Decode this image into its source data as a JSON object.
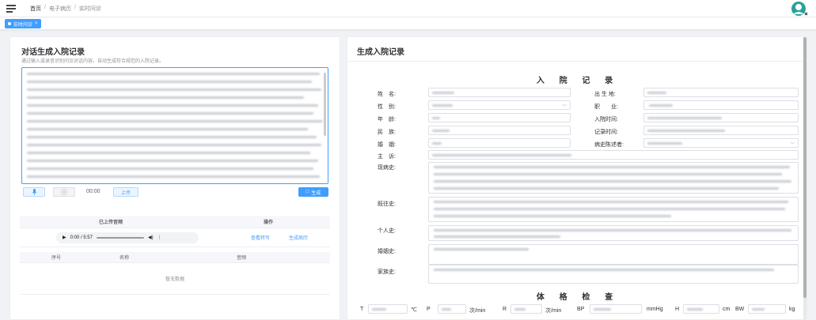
{
  "breadcrumb": {
    "home": "首页",
    "sep": "/",
    "level2": "电子病历",
    "level3": "实时问诊"
  },
  "tag": {
    "label": "实时问诊",
    "close": "×"
  },
  "left": {
    "title": "对话生成入院记录",
    "subtitle": "通过输入或录音识别问诊对话内容，自动生成符合规范的入院记录。",
    "timer": "00:00",
    "upload_label": "上传",
    "generate_label": "生成",
    "generate_icon": "□",
    "table": {
      "headers": [
        "已上传音频",
        "操作"
      ],
      "audio_time": "0:00 / 5:57",
      "actions": [
        "查看转写",
        "生成病历"
      ],
      "headers2": [
        "序号",
        "名称",
        "音频"
      ],
      "empty": "暂无数据"
    }
  },
  "right": {
    "title": "生成入院记录",
    "record_title": "入 院 记 录",
    "fields": {
      "name": "姓　名:",
      "birthplace": "出 生 地:",
      "gender": "性　别:",
      "occupation": "职　　业:",
      "age": "年　龄:",
      "admit_time": "入院时间:",
      "ethnicity": "民　族:",
      "record_time": "记录时间:",
      "marriage": "婚　姻:",
      "informant": "病史陈述者:",
      "chief": "主　诉:",
      "present": "现病史:",
      "past": "既往史:",
      "personal": "个人史:",
      "marital": "婚姻史:",
      "family": "家族史:"
    },
    "exam_title": "体 格 检 查",
    "vitals": {
      "t": "T",
      "t_unit": "℃",
      "p": "P",
      "p_unit": "次/min",
      "r": "R",
      "r_unit": "次/min",
      "bp": "BP",
      "bp_unit": "mmHg",
      "h": "H",
      "h_unit": "cm",
      "bw": "BW",
      "bw_unit": "kg"
    }
  }
}
